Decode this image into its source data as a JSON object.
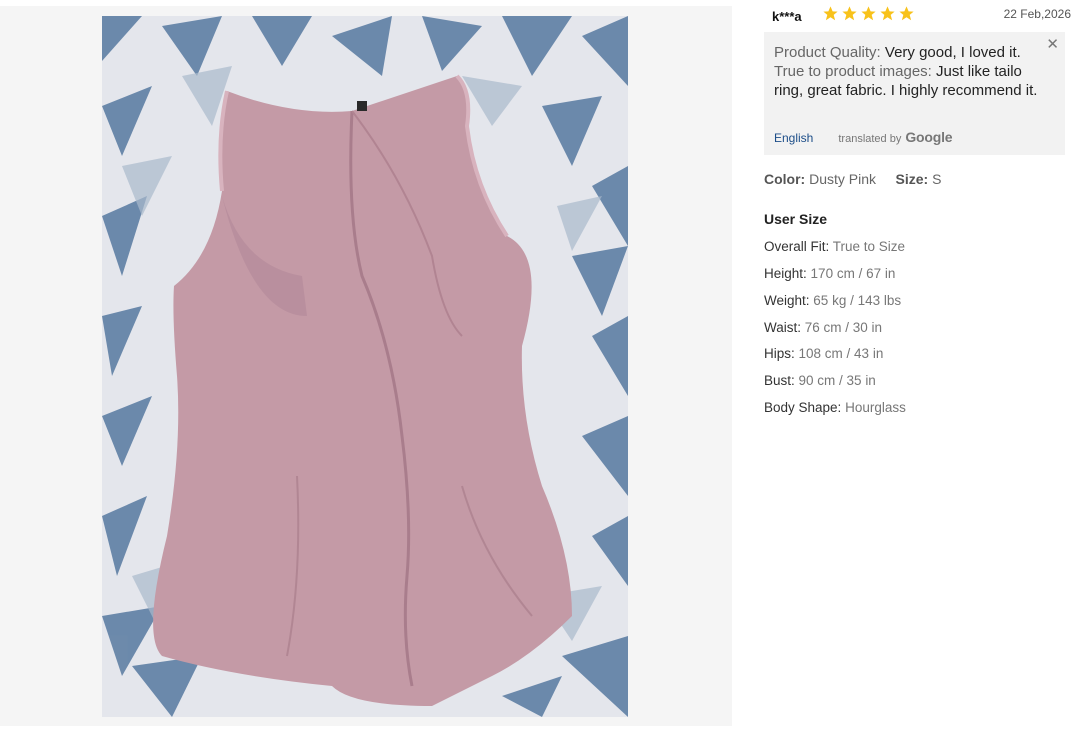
{
  "review": {
    "user": "k***a",
    "rating": 5,
    "date": "22 Feb,2026",
    "star_color": "#f8c21a"
  },
  "translation": {
    "quality_label": "Product Quality:",
    "quality_text": " Very good, I loved it.",
    "images_label": "True to product images:",
    "images_text": " Just like tailo ring, great fabric. I highly recommend it.",
    "language_link": "English",
    "translated_by": "translated by",
    "provider": "Google",
    "close_icon": "close-icon"
  },
  "variant": {
    "color_label": "Color:",
    "color_value": "Dusty Pink",
    "size_label": "Size:",
    "size_value": "S"
  },
  "user_size": {
    "title": "User Size",
    "rows": [
      {
        "label": "Overall Fit:",
        "value": "True to Size"
      },
      {
        "label": "Height:",
        "value": "170 cm / 67 in"
      },
      {
        "label": "Weight:",
        "value": "65 kg / 143 lbs"
      },
      {
        "label": "Waist:",
        "value": "76 cm / 30 in"
      },
      {
        "label": "Hips:",
        "value": "108 cm / 43 in"
      },
      {
        "label": "Bust:",
        "value": "90 cm / 35 in"
      },
      {
        "label": "Body Shape:",
        "value": "Hourglass"
      }
    ]
  },
  "photo": {
    "description_icon": "review-photo",
    "garment_color": "#c49aa6",
    "bedsheet_color": "#e6e8ee",
    "pattern_color": "#5d7ea3"
  }
}
